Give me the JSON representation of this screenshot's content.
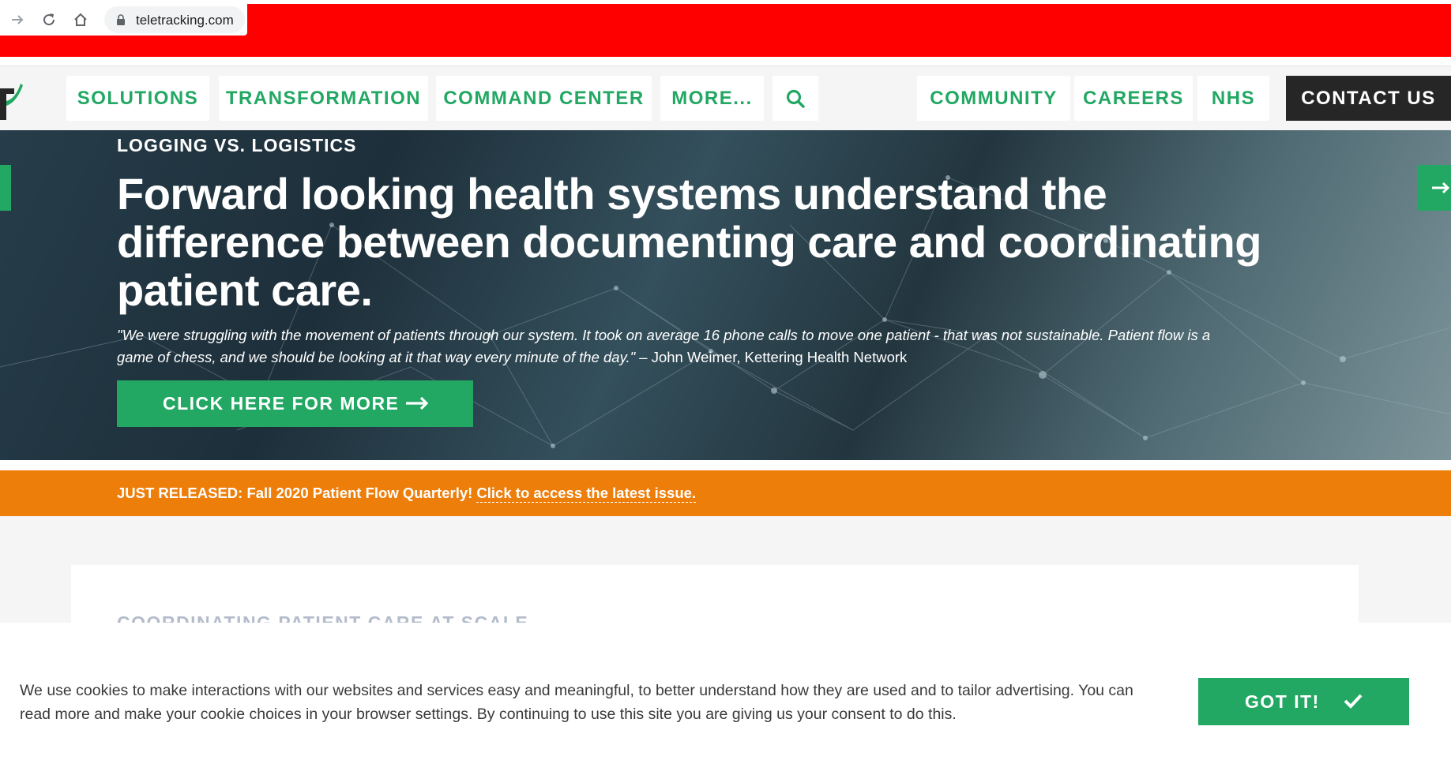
{
  "browser": {
    "url": "teletracking.com"
  },
  "nav": {
    "items": [
      {
        "label": "SOLUTIONS"
      },
      {
        "label": "TRANSFORMATION"
      },
      {
        "label": "COMMAND CENTER"
      },
      {
        "label": "MORE..."
      }
    ],
    "right_items": [
      {
        "label": "COMMUNITY"
      },
      {
        "label": "CAREERS"
      },
      {
        "label": "NHS"
      }
    ],
    "contact_label": "CONTACT US"
  },
  "hero": {
    "eyebrow": "LOGGING VS. LOGISTICS",
    "title": "Forward looking health systems understand the difference between documenting care and coordinating patient care.",
    "quote": "\"We were struggling with the movement of patients through our system. It took on average 16 phone calls to move one patient - that was not sustainable. Patient flow is a game of chess, and we should be looking at it that way every minute of the day.\"",
    "attribution": " – John Weimer, Kettering Health Network",
    "cta_label": "CLICK HERE FOR MORE"
  },
  "announcement": {
    "lead": "JUST RELEASED: Fall 2020 Patient Flow Quarterly!",
    "link_text": "Click to access the latest issue."
  },
  "content": {
    "heading": "COORDINATING PATIENT CARE AT SCALE"
  },
  "cookie": {
    "text": "We use cookies to make interactions with our websites and services easy and meaningful, to better understand how they are used and to tailor advertising. You can read more and make your cookie choices in your browser settings. By continuing to use this site you are giving us your consent to do this.",
    "button_label": "GOT IT!"
  },
  "colors": {
    "brand_green": "#22a863",
    "announcement_orange": "#ee7e0a",
    "contact_dark": "#262626",
    "chrome_red": "#ff0000"
  },
  "icons": {
    "back": "arrow-right-icon",
    "reload": "reload-icon",
    "home": "home-icon",
    "lock": "lock-icon",
    "search": "search-icon",
    "cta_arrow": "arrow-right-icon",
    "slider_next": "arrow-right-icon",
    "check": "checkmark-icon"
  }
}
